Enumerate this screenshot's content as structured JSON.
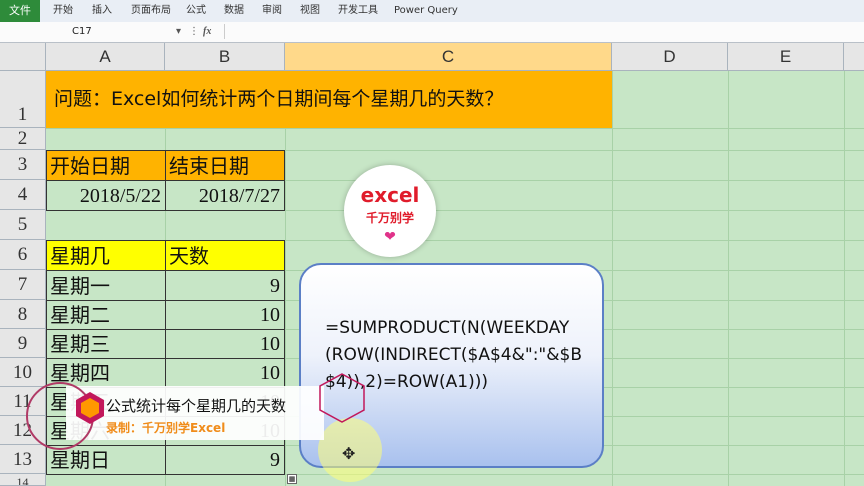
{
  "ribbon": {
    "file_tab": "文件",
    "tabs": [
      "开始",
      "插入",
      "页面布局",
      "公式",
      "数据",
      "审阅",
      "视图",
      "开发工具",
      "Power Query"
    ]
  },
  "formula_bar": {
    "name_box": "C17",
    "fx_icon": "fx-icon"
  },
  "columns": [
    "A",
    "B",
    "C",
    "D",
    "E"
  ],
  "rows": [
    "1",
    "2",
    "3",
    "4",
    "5",
    "6",
    "7",
    "8",
    "9",
    "10",
    "11",
    "12",
    "13",
    "14"
  ],
  "title": "问题：Excel如何统计两个日期间每个星期几的天数？",
  "date_table": {
    "start_header": "开始日期",
    "end_header": "结束日期",
    "start_value": "2018/5/22",
    "end_value": "2018/7/27"
  },
  "weekday_table": {
    "header_day": "星期几",
    "header_count": "天数",
    "rows": [
      {
        "day": "星期一",
        "count": "9"
      },
      {
        "day": "星期二",
        "count": "10"
      },
      {
        "day": "星期三",
        "count": "10"
      },
      {
        "day": "星期四",
        "count": "10"
      },
      {
        "day": "星期五",
        "count": "10"
      },
      {
        "day": "星期六",
        "count": "10"
      },
      {
        "day": "星期日",
        "count": "9"
      }
    ]
  },
  "formula_note": "=SUMPRODUCT(N(WEEKDAY(ROW(INDIRECT($A$4&\":\"&$B$4)),2)=ROW(A1)))",
  "logo": {
    "line1": "excel",
    "line2": "千万别学",
    "heart_icon": "heart-icon"
  },
  "overlay": {
    "title": "公式统计每个星期几的天数",
    "subtitle": "录制：千万别学Excel"
  },
  "colors": {
    "title_bg": "#ffb300",
    "header_bg": "#ffff00",
    "sheet_bg": "#c7e6c6",
    "file_tab": "#2e8b3a",
    "bubble_border": "#5b7fc6"
  }
}
